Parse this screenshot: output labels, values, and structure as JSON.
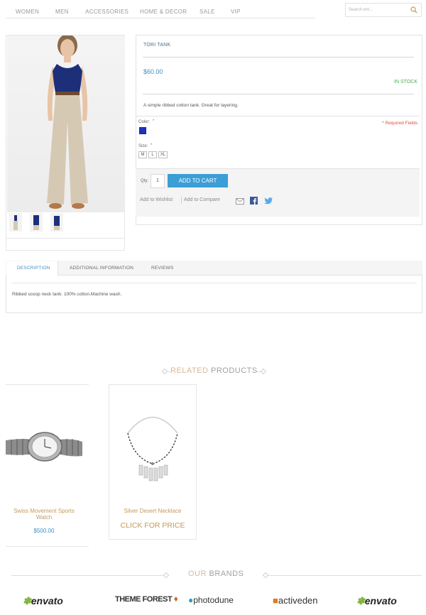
{
  "nav": {
    "items": [
      "WOMEN",
      "MEN",
      "ACCESSORIES",
      "HOME & DECOR",
      "SALE",
      "VIP"
    ],
    "search_placeholder": "Search ent..."
  },
  "product": {
    "name": "TORI TANK",
    "price": "$60.00",
    "stock": "IN STOCK",
    "short_description": "A simple ribbed cotton tank. Great for layering.",
    "color_label": "Color:",
    "required_star": "*",
    "required_note": "* Required Fields",
    "color_swatch": "#1f33b8",
    "size_label": "Size:",
    "sizes": [
      "M",
      "L",
      "XL"
    ],
    "qty_label": "Qty:",
    "qty_value": "1",
    "add_to_cart": "ADD TO CART",
    "add_to_wishlist": "Add to Wishlist",
    "add_to_compare": "Add to Compare"
  },
  "tabs": {
    "items": [
      "DESCRIPTION",
      "ADDITIONAL INFORMATION",
      "REVIEWS"
    ],
    "content": "Ribbed scoop neck tank. 100% cotton.Machine wash."
  },
  "related": {
    "title_a": "RELATED",
    "title_b": " PRODUCTS",
    "products": [
      {
        "name": "Swiss Movement Sports Watch",
        "price": "$500.00"
      },
      {
        "name": "Silver Desert Necklace",
        "price": "CLICK FOR PRICE"
      }
    ]
  },
  "brands": {
    "title_a": "OUR",
    "title_b": " BRANDS",
    "items": [
      "envato",
      "THEME FOREST",
      "photodune",
      "activeden",
      "envato"
    ]
  },
  "colors": {
    "accent": "#3b9ed6",
    "price": "#3c8fbf",
    "stock": "#4caf50",
    "required": "#e0503a",
    "product_name_gold": "#c4995c"
  }
}
